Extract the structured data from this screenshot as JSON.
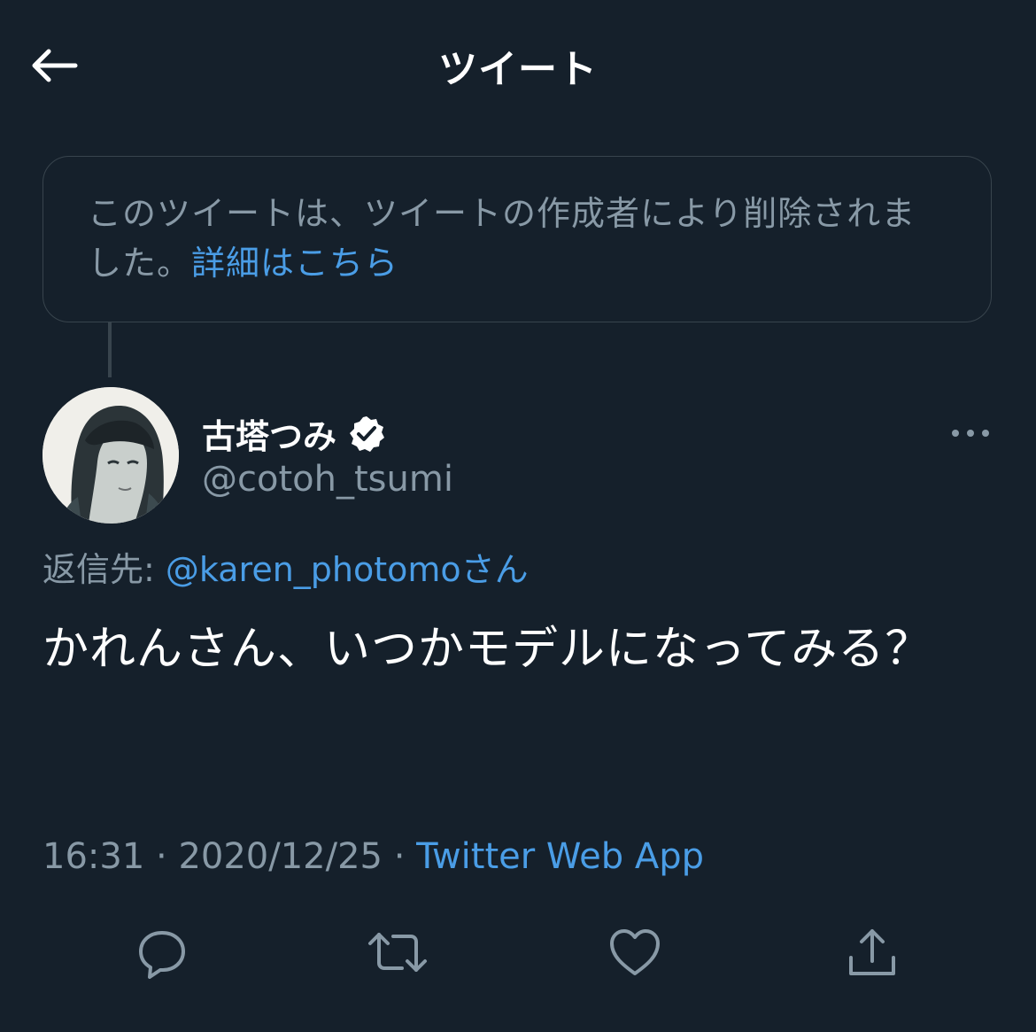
{
  "header": {
    "title": "ツイート",
    "back_icon": "arrow-left-icon"
  },
  "deleted_notice": {
    "text": "このツイートは、ツイートの作成者により削除されました。",
    "link": "詳細はこちら"
  },
  "tweet": {
    "display_name": "古塔つみ",
    "verified_icon": "verified-badge-icon",
    "handle": "@cotoh_tsumi",
    "reply_label": "返信先:",
    "reply_handle": "@karen_photomo",
    "reply_suffix": "さん",
    "text": "かれんさん、いつかモデルになってみる？",
    "time": "16:31",
    "separator": "·",
    "date": "2020/12/25",
    "source": "Twitter Web App"
  },
  "actions": [
    {
      "icon": "reply-icon"
    },
    {
      "icon": "retweet-icon"
    },
    {
      "icon": "like-icon"
    },
    {
      "icon": "share-icon"
    }
  ],
  "colors": {
    "background": "#15202b",
    "muted_text": "#8899a6",
    "link": "#4a9de6",
    "border": "#38444d"
  }
}
